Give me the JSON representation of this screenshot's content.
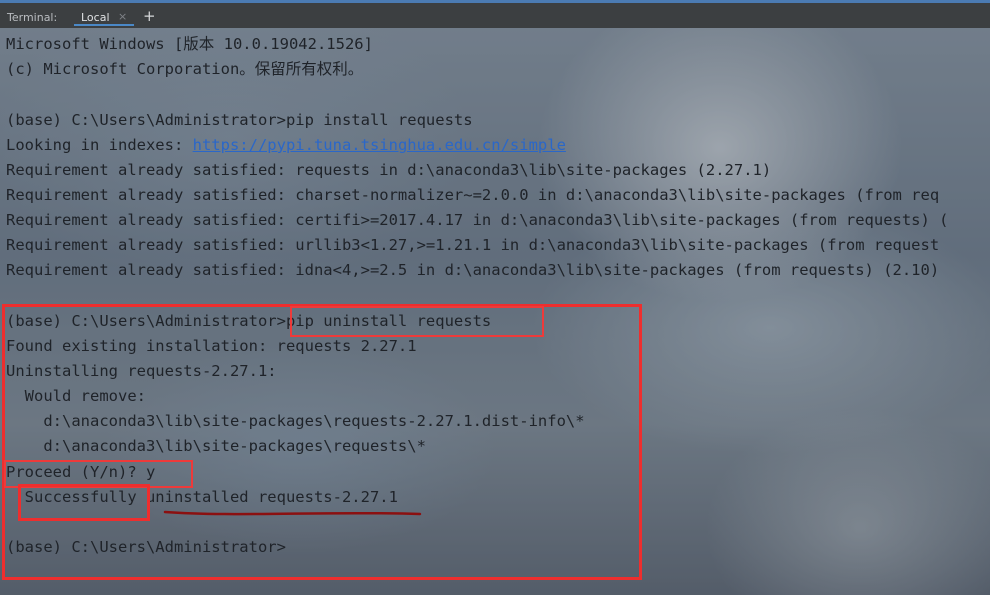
{
  "tabbar": {
    "title": "Terminal:",
    "tab_local": "Local",
    "close_glyph": "×",
    "add_glyph": "+"
  },
  "terminal": {
    "lines": [
      "Microsoft Windows [版本 10.0.19042.1526]",
      "(c) Microsoft Corporation。保留所有权利。",
      "",
      "(base) C:\\Users\\Administrator>pip install requests",
      "Looking in indexes: ",
      "Requirement already satisfied: requests in d:\\anaconda3\\lib\\site-packages (2.27.1)",
      "Requirement already satisfied: charset-normalizer~=2.0.0 in d:\\anaconda3\\lib\\site-packages (from req",
      "Requirement already satisfied: certifi>=2017.4.17 in d:\\anaconda3\\lib\\site-packages (from requests) (",
      "Requirement already satisfied: urllib3<1.27,>=1.21.1 in d:\\anaconda3\\lib\\site-packages (from request",
      "Requirement already satisfied: idna<4,>=2.5 in d:\\anaconda3\\lib\\site-packages (from requests) (2.10)",
      "",
      "(base) C:\\Users\\Administrator>pip uninstall requests",
      "Found existing installation: requests 2.27.1",
      "Uninstalling requests-2.27.1:",
      "  Would remove:",
      "    d:\\anaconda3\\lib\\site-packages\\requests-2.27.1.dist-info\\*",
      "    d:\\anaconda3\\lib\\site-packages\\requests\\*",
      "Proceed (Y/n)? y",
      "  Successfully uninstalled requests-2.27.1",
      "",
      "(base) C:\\Users\\Administrator>"
    ],
    "index_url": "https://pypi.tuna.tsinghua.edu.cn/simple"
  },
  "colors": {
    "annotation_red": "#ee2e2e",
    "underline_dark_red": "#8b1010",
    "link_blue": "#2a67c9"
  }
}
